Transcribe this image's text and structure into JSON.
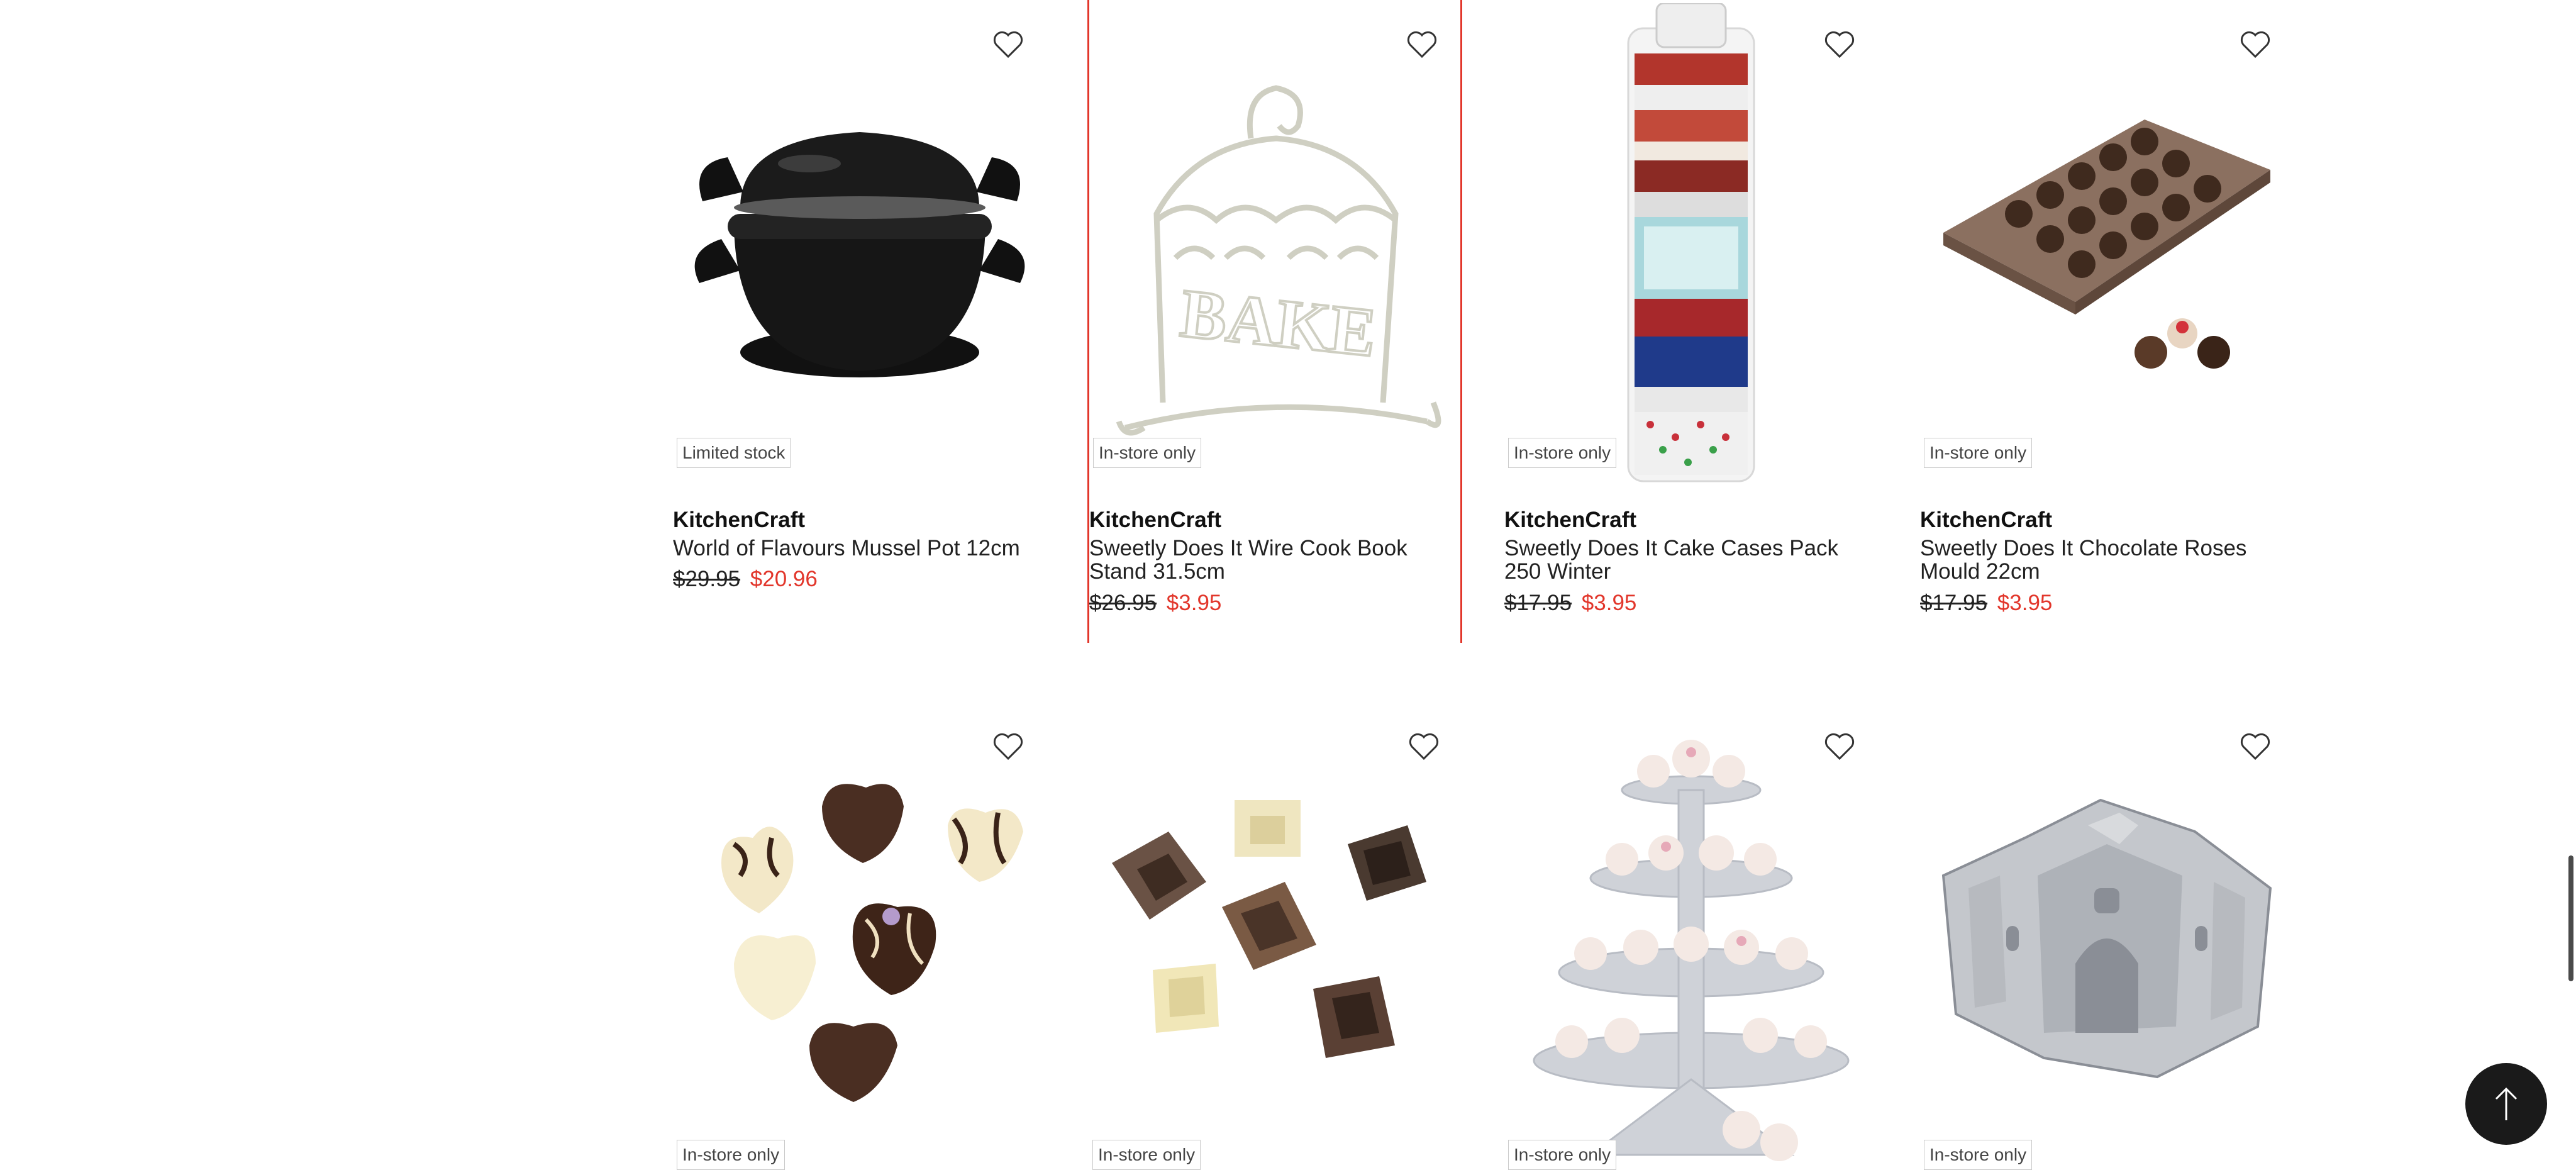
{
  "products": [
    {
      "brand": "KitchenCraft",
      "name": "World of Flavours Mussel Pot 12cm",
      "was_price": "$29.95",
      "now_price": "$20.96",
      "badge": "Limited stock",
      "image": "mussel-pot"
    },
    {
      "brand": "KitchenCraft",
      "name": "Sweetly Does It Wire Cook Book Stand 31.5cm",
      "was_price": "$26.95",
      "now_price": "$3.95",
      "badge": "In-store only",
      "image": "cook-book-stand"
    },
    {
      "brand": "KitchenCraft",
      "name": "Sweetly Does It Cake Cases Pack 250 Winter",
      "was_price": "$17.95",
      "now_price": "$3.95",
      "badge": "In-store only",
      "image": "cake-cases"
    },
    {
      "brand": "KitchenCraft",
      "name": "Sweetly Does It Chocolate Roses Mould 22cm",
      "was_price": "$17.95",
      "now_price": "$3.95",
      "badge": "In-store only",
      "image": "chocolate-mould"
    },
    {
      "badge": "In-store only",
      "image": "chocolate-hearts"
    },
    {
      "badge": "In-store only",
      "image": "chocolate-cups"
    },
    {
      "badge": "In-store only",
      "image": "cupcake-stand"
    },
    {
      "badge": "In-store only",
      "image": "castle-tin"
    }
  ],
  "colors": {
    "sale": "#e2362b",
    "selected_outline": "#e2362b",
    "back_to_top_bg": "#1a1a1a"
  },
  "icons": {
    "wishlist": "heart-outline-icon",
    "back_to_top": "arrow-up-icon"
  }
}
